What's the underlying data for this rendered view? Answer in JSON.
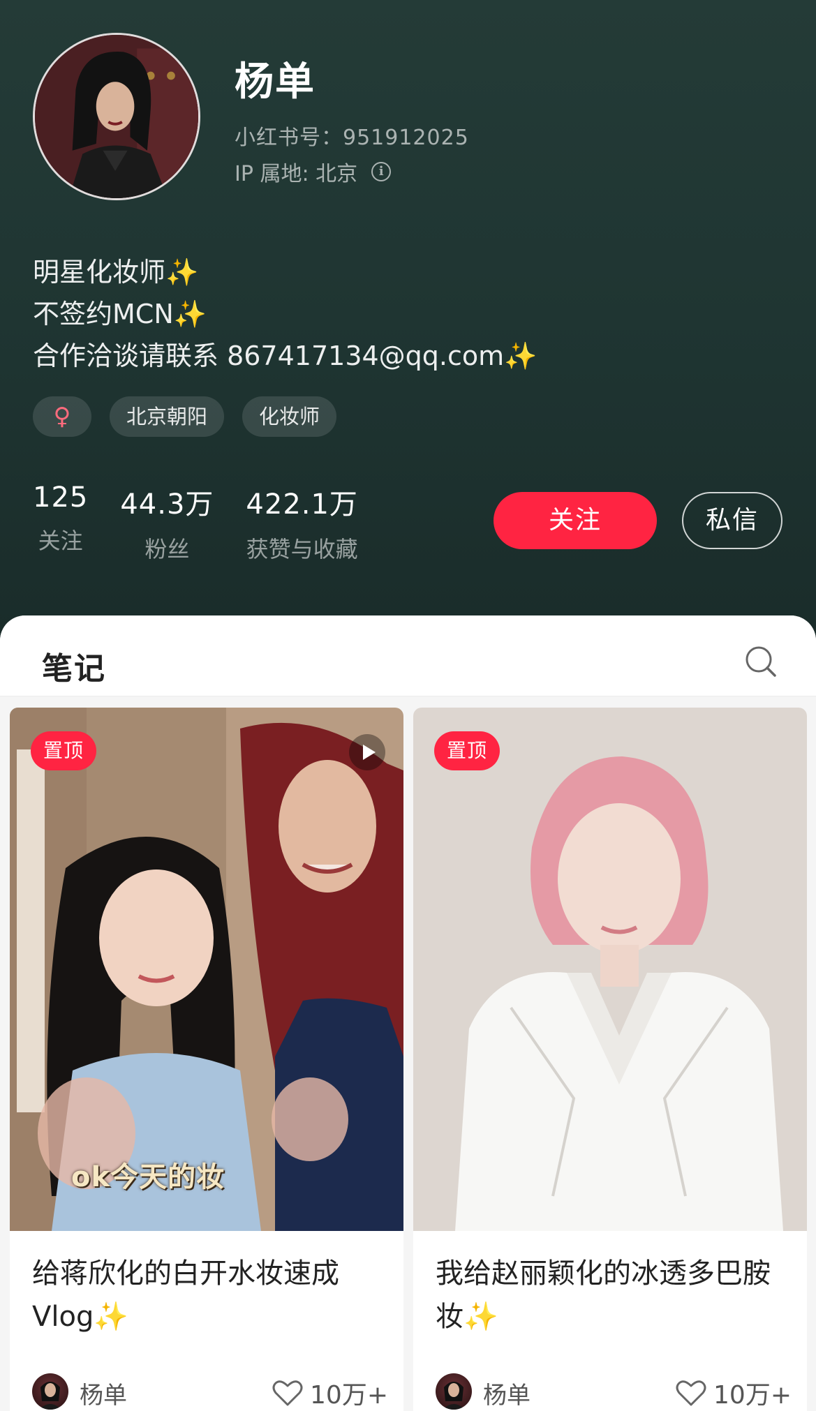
{
  "profile": {
    "nickname": "杨单",
    "red_id": "小红书号：951912025",
    "ip_location": "IP 属地: 北京",
    "info_icon": "i",
    "bio_lines": [
      {
        "text": "明星化妆师",
        "emoji": "✨"
      },
      {
        "text": "不签约MCN",
        "emoji": "✨"
      },
      {
        "text": "合作洽谈请联系 867417134@qq.com",
        "emoji": "✨"
      }
    ],
    "tags": {
      "gender_icon": "♀",
      "location": "北京朝阳",
      "profession": "化妆师"
    },
    "stats": [
      {
        "num": "125",
        "label": "关注"
      },
      {
        "num": "44.3万",
        "label": "粉丝"
      },
      {
        "num": "422.1万",
        "label": "获赞与收藏"
      }
    ],
    "follow_label": "关注",
    "message_label": "私信"
  },
  "notes": {
    "title": "笔记",
    "cards": [
      {
        "pin_label": "置顶",
        "is_video": true,
        "subtitle_overlay": "ok今天的妆",
        "title": "给蒋欣化的白开水妆速成Vlog✨",
        "author": "杨单",
        "likes": "10万+"
      },
      {
        "pin_label": "置顶",
        "is_video": false,
        "title": "我给赵丽颖化的冰透多巴胺妆✨",
        "author": "杨单",
        "likes": "10万+"
      }
    ]
  },
  "colors": {
    "accent": "#ff2442",
    "header_bg": "#1f3532"
  }
}
